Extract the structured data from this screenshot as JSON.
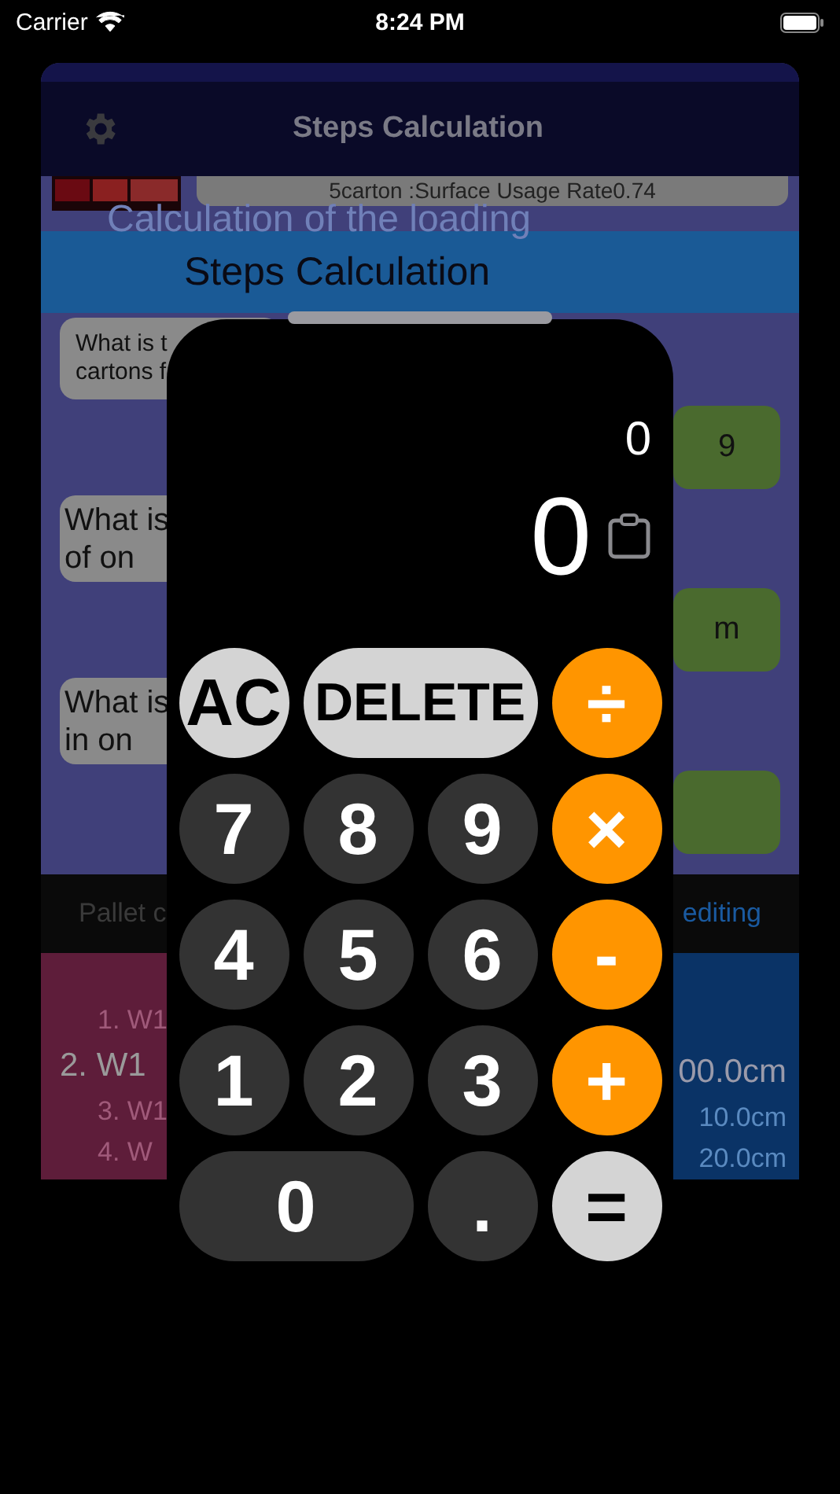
{
  "status_bar": {
    "carrier": "Carrier",
    "time": "8:24 PM"
  },
  "background": {
    "nav_title": "Steps Calculation",
    "usage_text": "5carton :Surface Usage Rate0.74",
    "faint_heading": "Calculation of the loading",
    "section_title": "Steps Calculation",
    "messages": [
      {
        "kind": "note",
        "lines": [
          "What is t",
          "cartons f"
        ]
      },
      {
        "kind": "answer",
        "text": "9"
      },
      {
        "kind": "question",
        "lines": [
          "What is",
          "of on"
        ]
      },
      {
        "kind": "answer",
        "text": "m"
      },
      {
        "kind": "question",
        "lines": [
          "What is",
          "in on"
        ]
      },
      {
        "kind": "answer"
      }
    ],
    "tab_left": "Pallet c",
    "tab_right": "editing",
    "left_picker": [
      {
        "text": "1. W1",
        "selected": false
      },
      {
        "text": "2. W1",
        "selected": true
      },
      {
        "text": "3. W1",
        "selected": false
      },
      {
        "text": "4. W",
        "selected": false
      }
    ],
    "right_picker": [
      {
        "text": "00.0cm",
        "selected": true
      },
      {
        "text": "10.0cm",
        "selected": false
      },
      {
        "text": "20.0cm",
        "selected": false
      }
    ]
  },
  "calculator": {
    "expression": "0",
    "display": "0",
    "keys": [
      {
        "label": "AC",
        "kind": "light",
        "wide": false
      },
      {
        "label": "DELETE",
        "kind": "light",
        "wide": true
      },
      {
        "label": "÷",
        "kind": "orange",
        "wide": false
      },
      {
        "label": "7",
        "kind": "dark",
        "wide": false
      },
      {
        "label": "8",
        "kind": "dark",
        "wide": false
      },
      {
        "label": "9",
        "kind": "dark",
        "wide": false
      },
      {
        "label": "×",
        "kind": "orange",
        "wide": false
      },
      {
        "label": "4",
        "kind": "dark",
        "wide": false
      },
      {
        "label": "5",
        "kind": "dark",
        "wide": false
      },
      {
        "label": "6",
        "kind": "dark",
        "wide": false
      },
      {
        "label": "-",
        "kind": "orange",
        "wide": false
      },
      {
        "label": "1",
        "kind": "dark",
        "wide": false
      },
      {
        "label": "2",
        "kind": "dark",
        "wide": false
      },
      {
        "label": "3",
        "kind": "dark",
        "wide": false
      },
      {
        "label": "+",
        "kind": "orange",
        "wide": false
      },
      {
        "label": "0",
        "kind": "dark",
        "wide": true
      },
      {
        "label": ".",
        "kind": "dark",
        "wide": false
      },
      {
        "label": "=",
        "kind": "light",
        "wide": false
      }
    ]
  }
}
